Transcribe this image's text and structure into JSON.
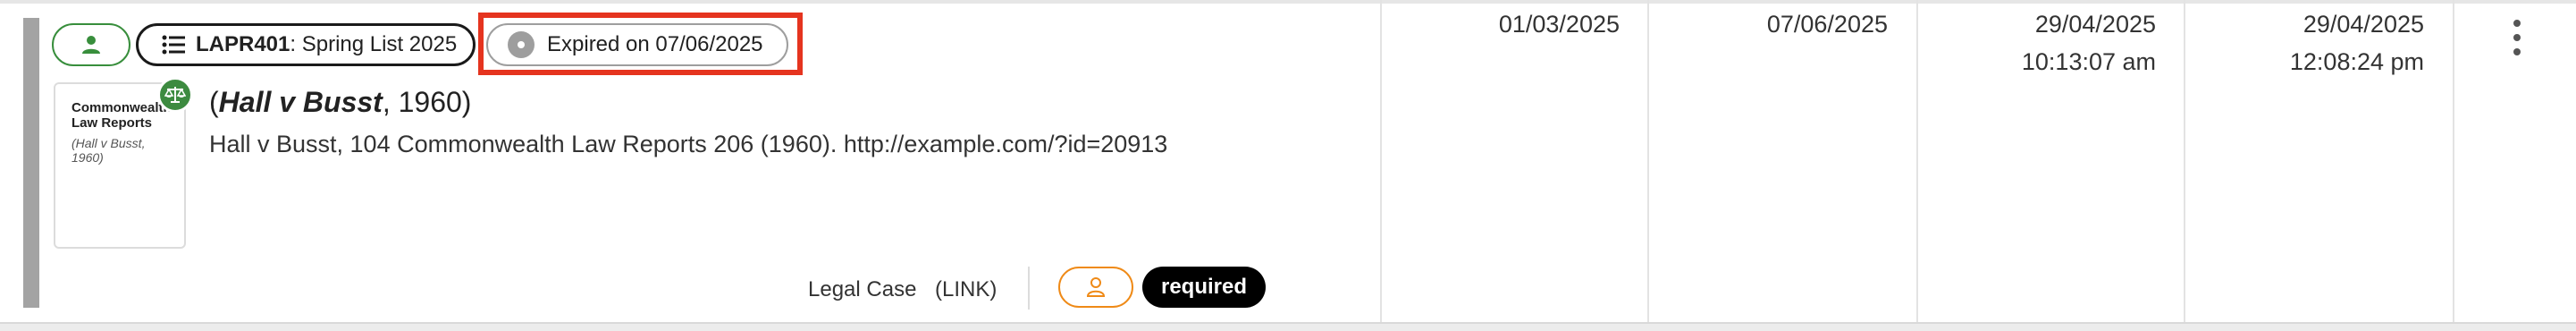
{
  "row": {
    "list": {
      "code": "LAPR401",
      "name": "Spring List 2025",
      "separator": ": "
    },
    "status": {
      "label": "Expired on 07/06/2025"
    },
    "thumbnail": {
      "title": "Commonwealth Law Reports",
      "subtitle": "(Hall v Busst, 1960)"
    },
    "title": {
      "italic": "Hall v Busst",
      "rest": ", 1960)",
      "open": "("
    },
    "citation": "Hall v Busst, 104 Commonwealth Law Reports 206 (1960). http://example.com/?id=20913",
    "type": "Legal Case",
    "link": "(LINK)",
    "tag_required": "required",
    "dates": {
      "col1": "01/03/2025",
      "col2": "07/06/2025",
      "col3_date": "29/04/2025",
      "col3_time": "10:13:07 am",
      "col4_date": "29/04/2025",
      "col4_time": "12:08:24 pm"
    }
  },
  "icons": {
    "user_pill": "person-icon",
    "list": "list-icon",
    "status": "disc-icon",
    "badge": "scale-icon",
    "owner": "person-outline-icon",
    "menu": "kebab-menu-icon"
  },
  "colors": {
    "green": "#388e3c",
    "highlight": "#e5341f",
    "orange": "#ef8a17",
    "accent_bar": "#a3a3a3"
  }
}
